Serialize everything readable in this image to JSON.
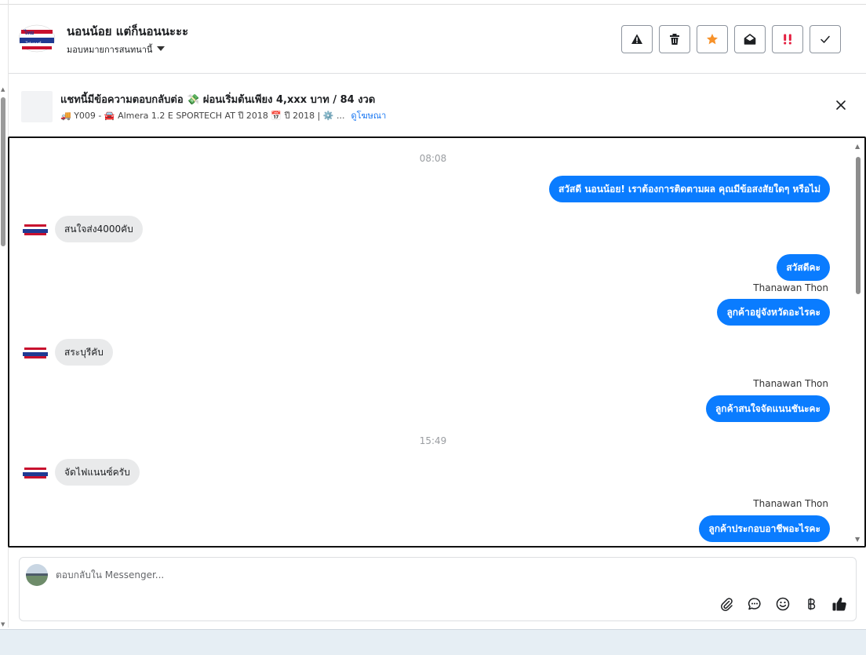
{
  "header": {
    "page_name": "นอนน้อย แต่ก็นอนนะะะ",
    "assign_label": "มอบหมายการสนทนานี้",
    "actions": [
      "warning-icon",
      "trash-icon",
      "star-icon",
      "mark-read-icon",
      "spam-icon",
      "done-icon"
    ],
    "star_color": "#f7922a",
    "spam_color": "#e41e3f"
  },
  "ad": {
    "title": "แชทนี้มีข้อความตอบกลับต่อ 💸 ผ่อนเริ่มต้นเพียง 4,xxx บาท / 84 งวด",
    "subtitle": "🚚 Y009 - 🚘 Almera 1.2 E SPORTECH AT ปี 2018 📅 ปี 2018 | ⚙️ ...",
    "link": "ดูโฆษณา"
  },
  "chat": {
    "timestamps": [
      "08:08",
      "15:49"
    ],
    "messages": [
      {
        "dir": "out",
        "text": "สวัสดี นอนน้อย! เราต้องการติดตามผล คุณมีข้อสงสัยใดๆ หรือไม่"
      },
      {
        "dir": "in",
        "text": "สนใจส่ง4000คับ"
      },
      {
        "dir": "out",
        "text": "สวัสดีคะ"
      },
      {
        "dir": "out",
        "sender": "Thanawan Thon",
        "text": "ลูกค้าอยู่จังหวัดอะไรคะ"
      },
      {
        "dir": "in",
        "text": "สระบุรีคับ"
      },
      {
        "dir": "out",
        "sender": "Thanawan Thon",
        "text": "ลูกค้าสนใจจัดแนนชันะคะ"
      },
      {
        "dir": "in",
        "text": "จัดไฟแนนซ์ครับ"
      },
      {
        "dir": "out",
        "sender": "Thanawan Thon",
        "text": "ลูกค้าประกอบอาชีพอะไรคะ"
      }
    ]
  },
  "composer": {
    "placeholder": "ตอบกลับใน Messenger...",
    "tools": [
      "attach-icon",
      "saved-reply-icon",
      "emoji-icon",
      "baht-icon",
      "like-icon"
    ]
  },
  "colors": {
    "outgoing_bubble": "#0a7cff",
    "incoming_bubble": "#e9eaeb",
    "link": "#1876f2"
  }
}
